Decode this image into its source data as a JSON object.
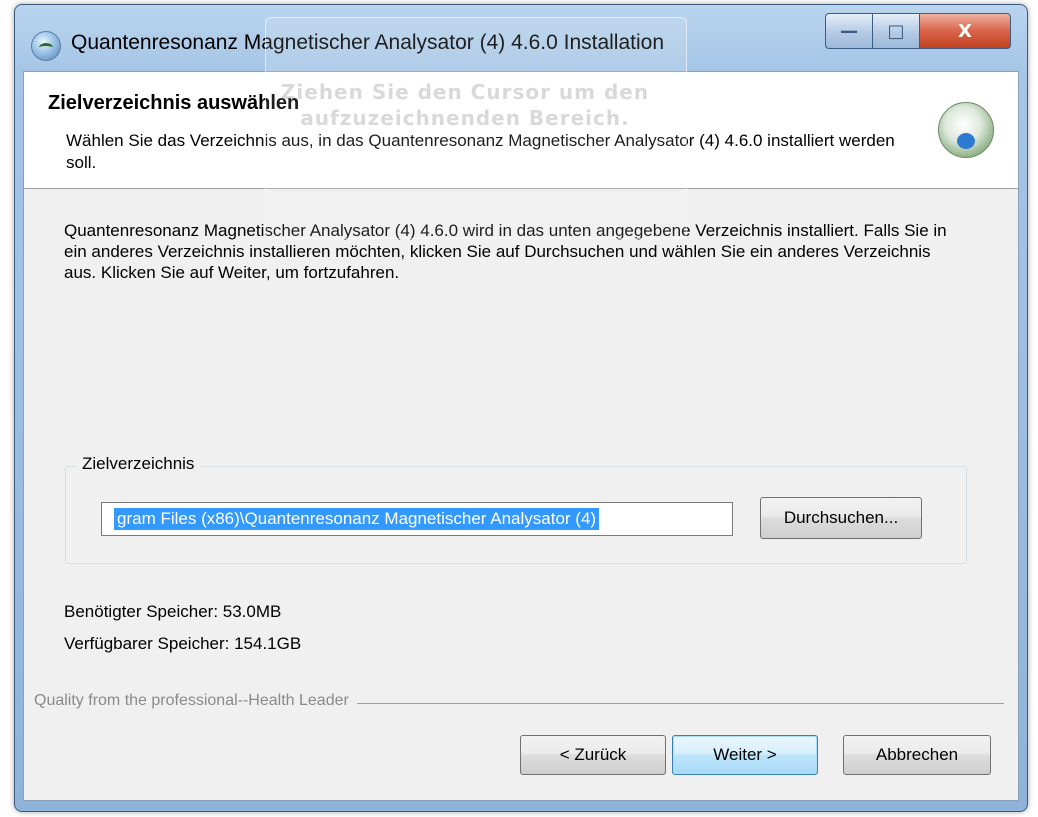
{
  "window": {
    "title": "Quantenresonanz Magnetischer Analysator (4) 4.6.0 Installation",
    "controls": {
      "minimize": "—",
      "maximize": "□",
      "close": "X"
    }
  },
  "overlay_hint": "Ziehen Sie den Cursor um den aufzuzeichnenden Bereich.",
  "header": {
    "title": "Zielverzeichnis auswählen",
    "subtitle": "Wählen Sie das Verzeichnis aus, in das Quantenresonanz Magnetischer Analysator (4) 4.6.0 installiert werden soll."
  },
  "description": "Quantenresonanz Magnetischer Analysator (4) 4.6.0 wird in das unten angegebene Verzeichnis installiert. Falls Sie in ein anderes Verzeichnis installieren möchten, klicken Sie auf Durchsuchen und wählen Sie ein anderes Verzeichnis aus. Klicken Sie auf Weiter, um fortzufahren.",
  "destination": {
    "group_label": "Zielverzeichnis",
    "path_value": "gram Files (x86)\\Quantenresonanz Magnetischer Analysator (4)",
    "browse_label": "Durchsuchen..."
  },
  "space": {
    "required": "Benötigter Speicher: 53.0MB",
    "available": "Verfügbarer Speicher: 154.1GB"
  },
  "branding": "Quality from the professional--Health Leader",
  "buttons": {
    "back": "< Zurück",
    "next": "Weiter >",
    "cancel": "Abbrechen"
  },
  "colors": {
    "selection": "#3399ff",
    "close_button": "#c0401f",
    "dialog_bg": "#f0f0f0"
  }
}
